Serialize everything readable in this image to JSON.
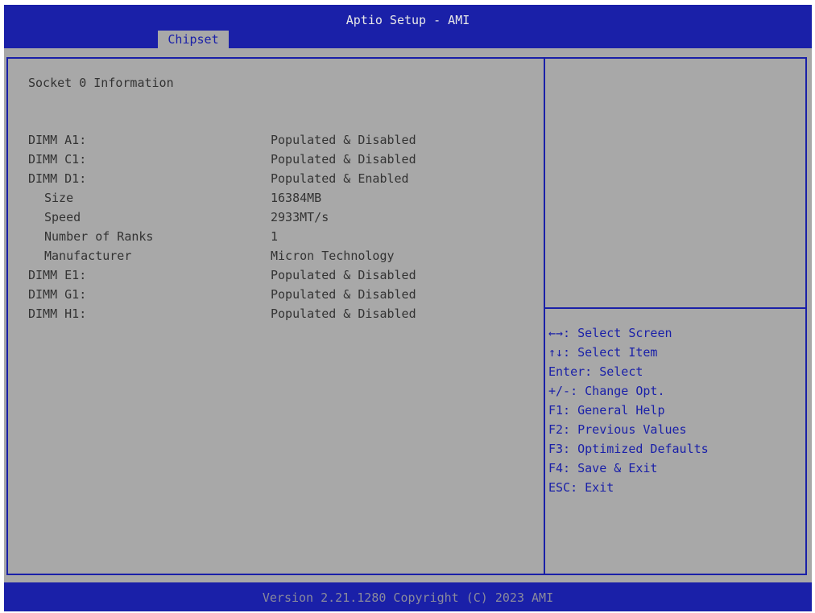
{
  "header": {
    "title": "Aptio Setup - AMI",
    "tabs": [
      {
        "label": "Chipset"
      }
    ]
  },
  "main": {
    "section_title": "Socket 0 Information",
    "rows": [
      {
        "label": "DIMM A1:",
        "value": "Populated & Disabled"
      },
      {
        "label": "DIMM C1:",
        "value": "Populated & Disabled"
      },
      {
        "label": "DIMM D1:",
        "value": "Populated & Enabled"
      },
      {
        "label": "Size",
        "value": "16384MB"
      },
      {
        "label": "Speed",
        "value": "2933MT/s"
      },
      {
        "label": "Number of Ranks",
        "value": "1"
      },
      {
        "label": "Manufacturer",
        "value": "Micron Technology"
      },
      {
        "label": "DIMM E1:",
        "value": "Populated & Disabled"
      },
      {
        "label": "DIMM G1:",
        "value": "Populated & Disabled"
      },
      {
        "label": "DIMM H1:",
        "value": "Populated & Disabled"
      }
    ]
  },
  "help": {
    "items": [
      "←→: Select Screen",
      "↑↓: Select Item",
      "Enter: Select",
      "+/-: Change Opt.",
      "F1: General Help",
      "F2: Previous Values",
      "F3: Optimized Defaults",
      "F4: Save & Exit",
      "ESC: Exit"
    ]
  },
  "footer": {
    "version": "Version 2.21.1280 Copyright (C) 2023 AMI"
  },
  "colors": {
    "bar_blue": "#1a20a8",
    "panel_gray": "#a8a8a8",
    "text_dark": "#333333"
  }
}
